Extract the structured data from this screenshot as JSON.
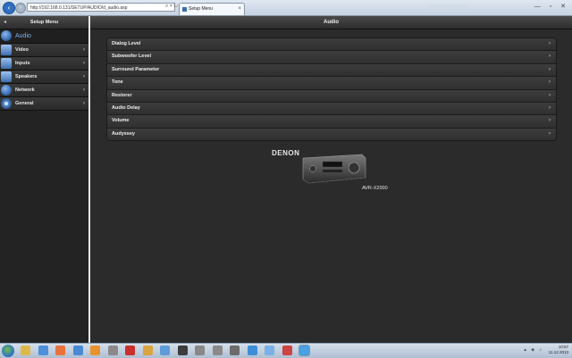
{
  "browser": {
    "address": "http://192.168.0.131/SETUP/AUDIO/d_audio.asp",
    "address_icons": "⌕ ▾ ↻ ✕",
    "tab_title": "Setup Menu",
    "tab_close": "×",
    "back_icon": "arrow-left-icon",
    "forward_icon": "arrow-right-icon",
    "window_controls": "— ▫ ✕"
  },
  "sidebar": {
    "back_arrow": "◂",
    "title": "Setup Menu",
    "items": [
      {
        "label": "Audio",
        "icon": "speaker-icon",
        "active": true
      },
      {
        "label": "Video",
        "icon": "monitor-icon",
        "chevron": "›"
      },
      {
        "label": "Inputs",
        "icon": "input-icon",
        "chevron": "›"
      },
      {
        "label": "Speakers",
        "icon": "speaker-config-icon",
        "chevron": "›"
      },
      {
        "label": "Network",
        "icon": "globe-icon",
        "chevron": "›"
      },
      {
        "label": "General",
        "icon": "gear-icon",
        "chevron": "›"
      }
    ]
  },
  "main": {
    "title": "Audio",
    "menu_items": [
      {
        "label": "Dialog Level",
        "chevron": "›"
      },
      {
        "label": "Subwoofer Level",
        "chevron": "›"
      },
      {
        "label": "Surround Parameter",
        "chevron": "›"
      },
      {
        "label": "Tone",
        "chevron": "›"
      },
      {
        "label": "Restorer",
        "chevron": "›"
      },
      {
        "label": "Audio Delay",
        "chevron": "›"
      },
      {
        "label": "Volume",
        "chevron": "›"
      },
      {
        "label": "Audyssey",
        "chevron": "›"
      }
    ],
    "brand": "DENON",
    "model": "AVR-X2000"
  },
  "taskbar": {
    "time": "10:57",
    "date": "11.12.2013",
    "tray_icons": "▴ ◈ ♪",
    "pinned_icons": [
      "folder-icon",
      "media-player-icon",
      "firefox-icon",
      "app-icon",
      "pet-icon",
      "app-icon",
      "app-icon",
      "app-icon",
      "app-icon",
      "app-icon",
      "app-icon",
      "app-icon",
      "app-icon",
      "chrome-icon",
      "app-icon",
      "app-icon",
      "internet-explorer-icon"
    ]
  },
  "colors": {
    "accent": "#7fb1ee",
    "background": "#2b2b2b",
    "menu_row": "#353535"
  }
}
